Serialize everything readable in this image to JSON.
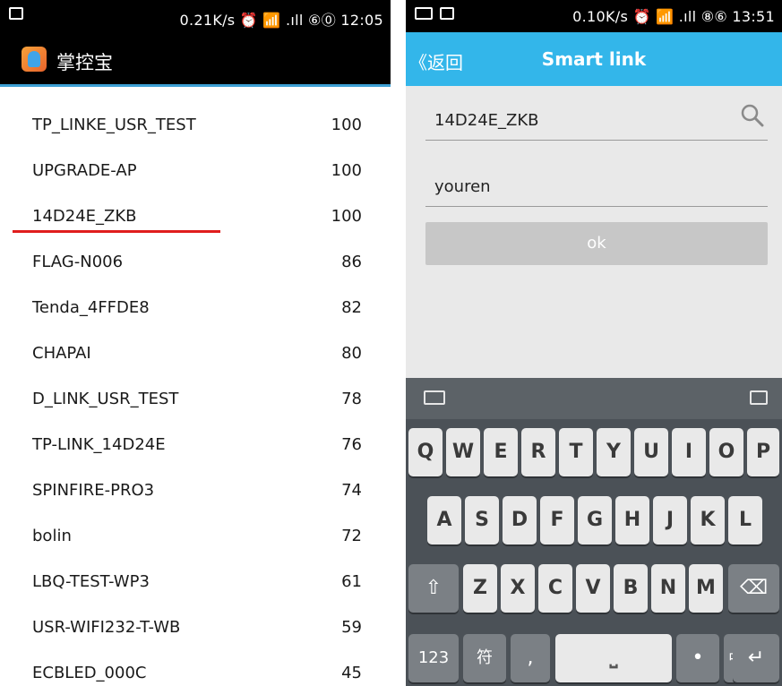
{
  "left": {
    "status": {
      "text": "0.21K/s ⏰ 📶 .ıll ⑥⓪ 12:05"
    },
    "app_title": "掌控宝",
    "networks": [
      {
        "name": "TP_LINKE_USR_TEST",
        "signal": "100"
      },
      {
        "name": "UPGRADE-AP",
        "signal": "100"
      },
      {
        "name": "14D24E_ZKB",
        "signal": "100"
      },
      {
        "name": "FLAG-N006",
        "signal": "86"
      },
      {
        "name": "Tenda_4FFDE8",
        "signal": "82"
      },
      {
        "name": "CHAPAI",
        "signal": "80"
      },
      {
        "name": "D_LINK_USR_TEST",
        "signal": "78"
      },
      {
        "name": "TP-LINK_14D24E",
        "signal": "76"
      },
      {
        "name": "SPINFIRE-PRO3",
        "signal": "74"
      },
      {
        "name": "bolin",
        "signal": "72"
      },
      {
        "name": "LBQ-TEST-WP3",
        "signal": "61"
      },
      {
        "name": "USR-WIFI232-T-WB",
        "signal": "59"
      },
      {
        "name": "ECBLED_000C",
        "signal": "45"
      }
    ]
  },
  "right": {
    "status": {
      "text": "0.10K/s ⏰ 📶 .ıll ⑧⑥ 13:51"
    },
    "back_label": "《返回",
    "title": "Smart link",
    "ssid_value": "14D24E_ZKB",
    "password_value": "youren",
    "ok_label": "ok",
    "keyboard": {
      "row1": [
        "Q",
        "W",
        "E",
        "R",
        "T",
        "Y",
        "U",
        "I",
        "O",
        "P"
      ],
      "row2": [
        "A",
        "S",
        "D",
        "F",
        "G",
        "H",
        "J",
        "K",
        "L"
      ],
      "row3": [
        "Z",
        "X",
        "C",
        "V",
        "B",
        "N",
        "M"
      ],
      "num_label": "123",
      "sym_label": "符",
      "comma_label": ",",
      "period_label": "•",
      "lang_label": "中/英",
      "enter_label": "↵",
      "shift_label": "⇧",
      "delete_label": "⌫",
      "space_label": "⎵"
    }
  }
}
